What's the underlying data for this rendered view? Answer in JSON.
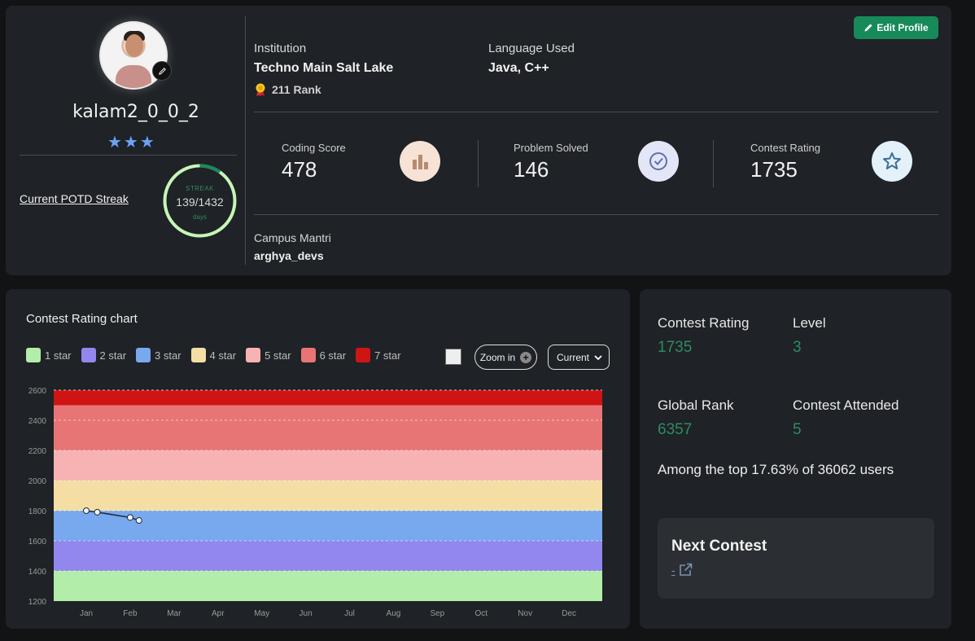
{
  "profile": {
    "username": "kalam2_0_0_2",
    "stars": "★★★",
    "potd_label": "Current POTD Streak",
    "streak": {
      "label": "STREAK",
      "value": "139/1432",
      "unit": "days",
      "current": 139,
      "total": 1432
    },
    "edit_button": "Edit Profile",
    "institution_label": "Institution",
    "institution_value": "Techno Main Salt Lake",
    "rank": "211 Rank",
    "language_label": "Language Used",
    "language_value": "Java, C++",
    "campus_label": "Campus Mantri",
    "campus_value": "arghya_devs"
  },
  "stats": {
    "coding_score_label": "Coding Score",
    "coding_score": "478",
    "problems_label": "Problem Solved",
    "problems": "146",
    "rating_label": "Contest Rating",
    "rating": "1735"
  },
  "colors": {
    "accent_green": "#178a5a",
    "value_green": "#2e8b62",
    "star_blue": "#6aa3f3"
  },
  "chart_panel": {
    "title": "Contest Rating chart",
    "zoom_label": "Zoom in",
    "select_value": "Current",
    "legend": [
      {
        "label": "1 star",
        "color": "#b2eda9"
      },
      {
        "label": "2 star",
        "color": "#9287ed"
      },
      {
        "label": "3 star",
        "color": "#78a8ed"
      },
      {
        "label": "4 star",
        "color": "#f4dea4"
      },
      {
        "label": "5 star",
        "color": "#f7b3b3"
      },
      {
        "label": "6 star",
        "color": "#e87575"
      },
      {
        "label": "7 star",
        "color": "#cf1414"
      }
    ]
  },
  "chart_data": {
    "type": "line",
    "title": "Contest Rating chart",
    "xlabel": "",
    "ylabel": "",
    "x_ticks": [
      "Jan",
      "Feb",
      "Mar",
      "Apr",
      "May",
      "Jun",
      "Jul",
      "Aug",
      "Sep",
      "Oct",
      "Nov",
      "Dec"
    ],
    "y_ticks": [
      1200,
      1400,
      1600,
      1800,
      2000,
      2200,
      2400,
      2600
    ],
    "ylim": [
      1200,
      2600
    ],
    "bands": [
      {
        "from": 1200,
        "to": 1400,
        "color": "#b2eda9"
      },
      {
        "from": 1400,
        "to": 1600,
        "color": "#9287ed"
      },
      {
        "from": 1600,
        "to": 1800,
        "color": "#78a8ed"
      },
      {
        "from": 1800,
        "to": 2000,
        "color": "#f4dea4"
      },
      {
        "from": 2000,
        "to": 2200,
        "color": "#f7b3b3"
      },
      {
        "from": 2200,
        "to": 2500,
        "color": "#e87575"
      },
      {
        "from": 2500,
        "to": 2600,
        "color": "#cf1414"
      }
    ],
    "series": [
      {
        "points": [
          {
            "month": 0.0,
            "value": 1800
          },
          {
            "month": 0.25,
            "value": 1790
          },
          {
            "month": 1.0,
            "value": 1755
          },
          {
            "month": 1.2,
            "value": 1735
          }
        ]
      }
    ]
  },
  "side_stats": {
    "rating_label": "Contest Rating",
    "rating": "1735",
    "level_label": "Level",
    "level": "3",
    "global_label": "Global Rank",
    "global": "6357",
    "attended_label": "Contest Attended",
    "attended": "5",
    "among": "Among the top 17.63% of 36062 users",
    "next_title": "Next Contest",
    "next_link": "-"
  }
}
